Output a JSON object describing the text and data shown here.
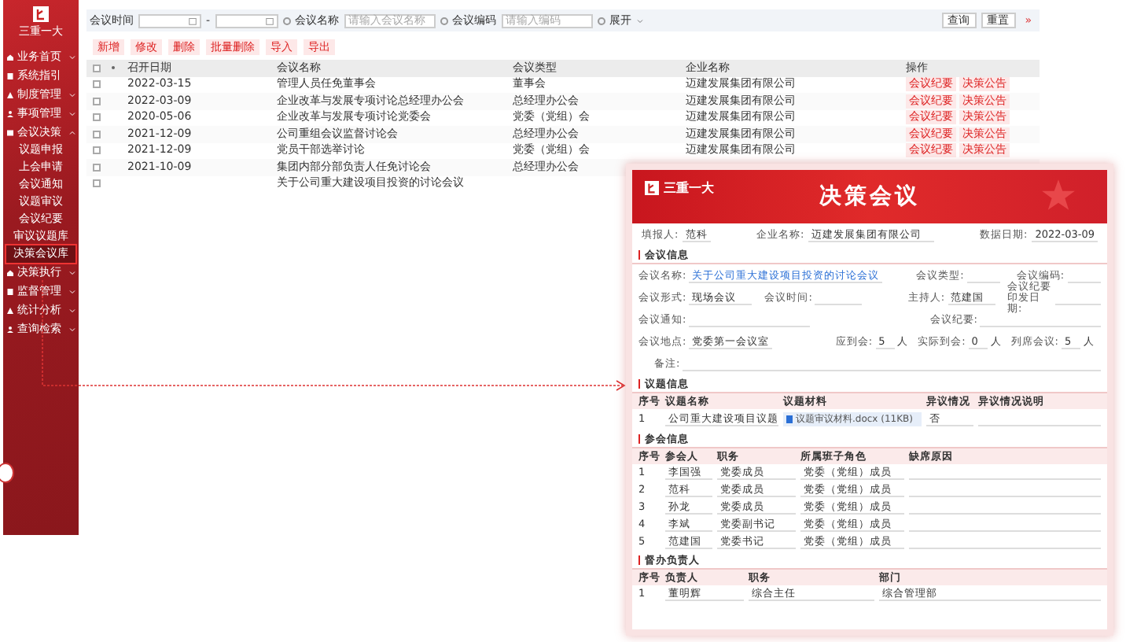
{
  "sidebar": {
    "logo_text": "三重一大",
    "items": [
      {
        "label": "业务首页",
        "kind": "group",
        "expanded": false
      },
      {
        "label": "系统指引",
        "kind": "link"
      },
      {
        "label": "制度管理",
        "kind": "group",
        "expanded": false
      },
      {
        "label": "事项管理",
        "kind": "group",
        "expanded": false
      },
      {
        "label": "会议决策",
        "kind": "group",
        "expanded": true,
        "children": [
          {
            "label": "议题申报",
            "selected": false
          },
          {
            "label": "上会申请",
            "selected": false
          },
          {
            "label": "会议通知",
            "selected": false
          },
          {
            "label": "议题审议",
            "selected": false
          },
          {
            "label": "会议纪要",
            "selected": false
          },
          {
            "label": "审议议题库",
            "selected": false
          },
          {
            "label": "决策会议库",
            "selected": true
          }
        ]
      },
      {
        "label": "决策执行",
        "kind": "group",
        "expanded": false
      },
      {
        "label": "监督管理",
        "kind": "group",
        "expanded": false
      },
      {
        "label": "统计分析",
        "kind": "group",
        "expanded": false
      },
      {
        "label": "查询检索",
        "kind": "group",
        "expanded": false
      }
    ]
  },
  "filter": {
    "date_label": "会议时间",
    "date_separator": "-",
    "name_label": "会议名称",
    "name_placeholder": "请输入会议名称",
    "code_label": "会议编码",
    "code_placeholder": "请输入编码",
    "expand": "展开",
    "query": "查询",
    "reset": "重置",
    "collapse": "»"
  },
  "toolbar": [
    "新增",
    "修改",
    "删除",
    "批量删除",
    "导入",
    "导出"
  ],
  "table": {
    "all_checked": false,
    "columns": [
      "召开日期",
      "会议名称",
      "会议类型",
      "企业名称",
      "操作"
    ],
    "rows": [
      {
        "checked": false,
        "date": "2022-03-15",
        "name": "管理人员任免董事会",
        "type": "董事会",
        "company": "迈建发展集团有限公司",
        "actions": [
          "会议纪要",
          "决策公告"
        ]
      },
      {
        "checked": false,
        "date": "2022-03-09",
        "name": "企业改革与发展专项讨论总经理办公会",
        "type": "总经理办公会",
        "company": "迈建发展集团有限公司",
        "actions": [
          "会议纪要",
          "决策公告"
        ]
      },
      {
        "checked": false,
        "date": "2020-05-06",
        "name": "企业改革与发展专项讨论党委会",
        "type": "党委（党组）会",
        "company": "迈建发展集团有限公司",
        "actions": [
          "会议纪要",
          "决策公告"
        ]
      },
      {
        "checked": false,
        "date": "2021-12-09",
        "name": "公司重组会议监督讨论会",
        "type": "总经理办公会",
        "company": "迈建发展集团有限公司",
        "actions": [
          "会议纪要",
          "决策公告"
        ]
      },
      {
        "checked": false,
        "date": "2021-12-09",
        "name": "党员干部选举讨论",
        "type": "党委（党组）会",
        "company": "迈建发展集团有限公司",
        "actions": [
          "会议纪要",
          "决策公告"
        ]
      },
      {
        "checked": false,
        "date": "2021-10-09",
        "name": "集团内部分部负责人任免讨论会",
        "type": "总经理办公会"
      },
      {
        "checked": false,
        "name": "关于公司重大建设项目投资的讨论会议"
      }
    ]
  },
  "detail": {
    "logo_text": "三重一大",
    "title": "决策会议",
    "header_fields": [
      {
        "label": "填报人:",
        "value": "范科"
      },
      {
        "label": "企业名称:",
        "value": "迈建发展集团有限公司"
      },
      {
        "label": "数据日期:",
        "value": "2022-03-09"
      }
    ],
    "meeting_section": "会议信息",
    "meeting_rows": [
      [
        {
          "label": "会议名称:",
          "value": "关于公司重大建设项目投资的讨论会议",
          "kind": "link"
        },
        {
          "label": "会议类型:"
        },
        {
          "label": "会议编码:"
        }
      ],
      [
        {
          "label": "会议形式:",
          "value": "现场会议"
        },
        {
          "label": "会议时间:"
        },
        {
          "label": "主持人:",
          "value": "范建国"
        },
        {
          "label": "会议纪要印发日期:"
        }
      ],
      [
        {
          "label": "会议通知:"
        },
        {
          "label": "会议纪要:"
        }
      ]
    ],
    "place": {
      "label": "会议地点:",
      "value": "党委第一会议室"
    },
    "counts": [
      {
        "label": "应到会:",
        "value": "5",
        "unit": "人"
      },
      {
        "label": "实际到会:",
        "value": "0",
        "unit": "人"
      },
      {
        "label": "列席会议:",
        "value": "5",
        "unit": "人"
      }
    ],
    "remark_label": "备注:",
    "topic_section": "议题信息",
    "topic_columns": [
      "序号",
      "议题名称",
      "议题材料",
      "异议情况",
      "异议情况说明"
    ],
    "topic_rows": [
      {
        "no": "1",
        "name": "公司重大建设项目议题",
        "file": "议题审议材料.docx (11KB)",
        "objection": "否"
      }
    ],
    "attendee_section": "参会信息",
    "attendee_columns": [
      "序号",
      "参会人",
      "职务",
      "所属班子角色",
      "缺席原因"
    ],
    "attendee_rows": [
      {
        "no": "1",
        "name": "李国强",
        "post": "党委成员",
        "role": "党委（党组）成员"
      },
      {
        "no": "2",
        "name": "范科",
        "post": "党委成员",
        "role": "党委（党组）成员"
      },
      {
        "no": "3",
        "name": "孙龙",
        "post": "党委成员",
        "role": "党委（党组）成员"
      },
      {
        "no": "4",
        "name": "李斌",
        "post": "党委副书记",
        "role": "党委（党组）成员"
      },
      {
        "no": "5",
        "name": "范建国",
        "post": "党委书记",
        "role": "党委（党组）成员"
      }
    ],
    "supervisor_section": "督办负责人",
    "supervisor_columns": [
      "序号",
      "负责人",
      "职务",
      "部门"
    ],
    "supervisor_rows": [
      {
        "no": "1",
        "name": "董明辉",
        "post": "综合主任",
        "dept": "综合管理部"
      }
    ]
  }
}
